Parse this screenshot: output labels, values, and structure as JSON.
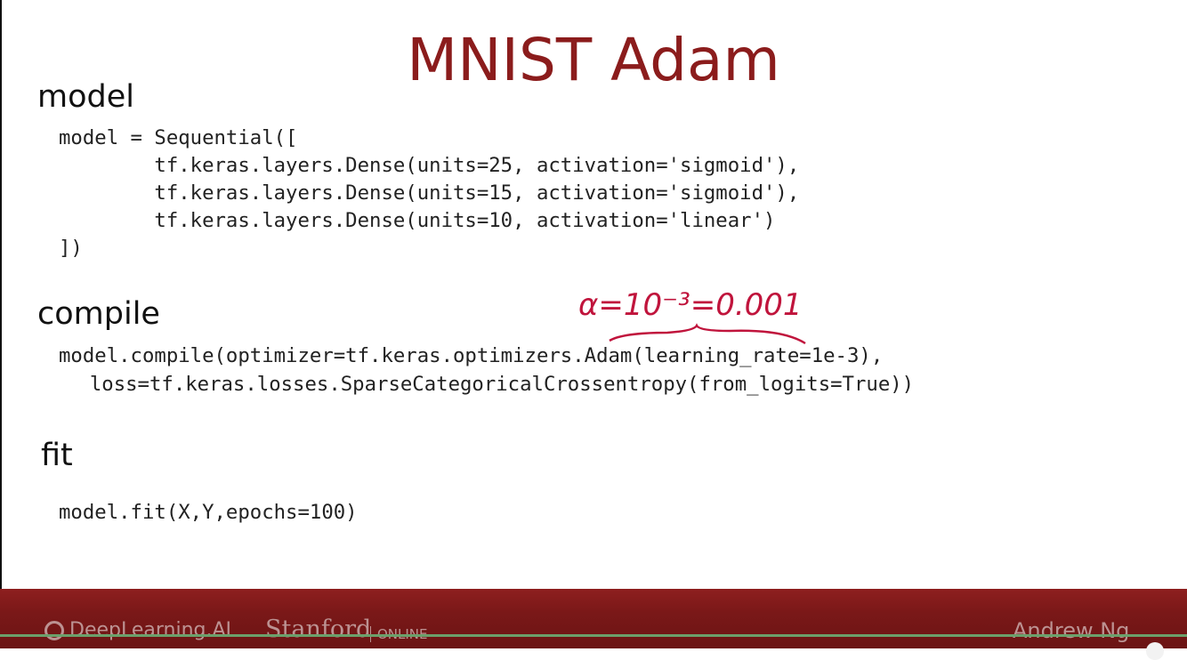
{
  "slide": {
    "title": "MNIST Adam",
    "sections": {
      "model": "model",
      "compile": "compile",
      "fit": "fit"
    },
    "code": {
      "model_lines": [
        "model = Sequential([",
        "        tf.keras.layers.Dense(units=25, activation='sigmoid'),",
        "        tf.keras.layers.Dense(units=15, activation='sigmoid'),",
        "        tf.keras.layers.Dense(units=10, activation='linear')",
        "])"
      ],
      "compile_lines": [
        "model.compile(optimizer=tf.keras.optimizers.Adam(learning_rate=1e-3),",
        "  loss=tf.keras.losses.SparseCategoricalCrossentropy(from_logits=True))"
      ],
      "fit_line": "model.fit(X,Y,epochs=100)"
    },
    "annotation": {
      "text": "α=10⁻³=0.001",
      "color": "#c0143c"
    }
  },
  "footer": {
    "brand_left": "DeepLearning.AI",
    "brand_mid": "Stanford",
    "brand_mid_sub": "ONLINE",
    "brand_right": "Andrew Ng",
    "background": "#7a1818"
  },
  "player": {
    "progress_color": "#6ba06b"
  }
}
